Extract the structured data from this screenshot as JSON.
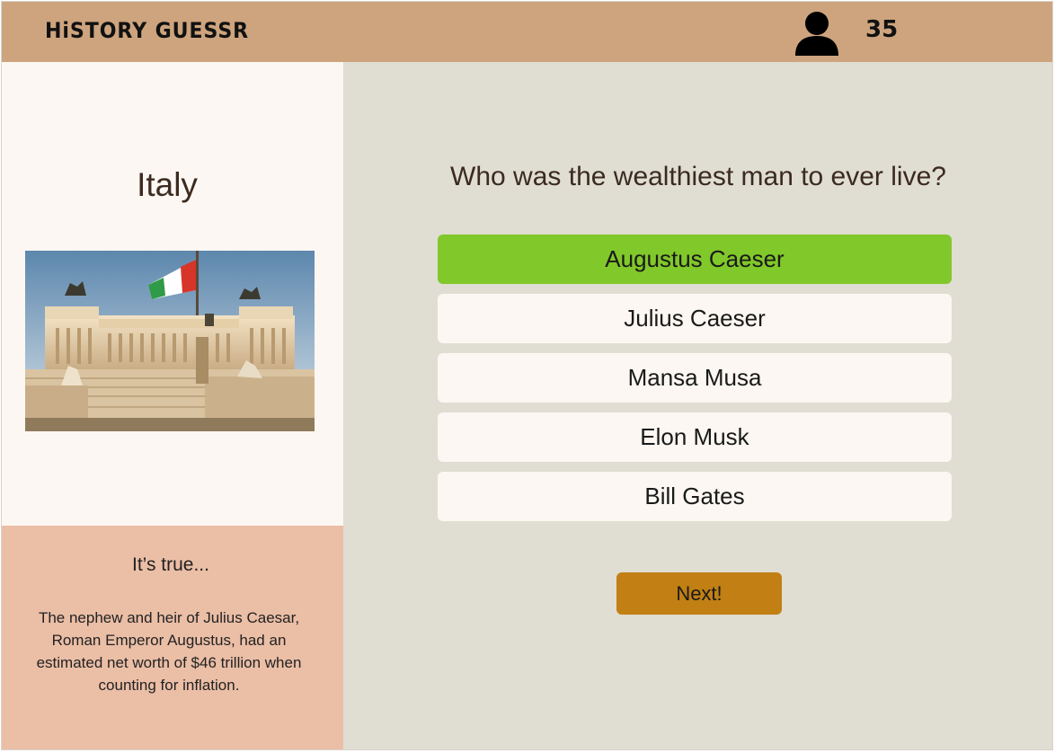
{
  "header": {
    "logo": "HiSTORY GUESSR",
    "score": "35",
    "user_icon": "user-icon"
  },
  "left_panel": {
    "country": "Italy",
    "image": "photo of the Altare della Patria monument in Rome with an Italian flag"
  },
  "fact": {
    "title": "It’s true...",
    "text": "The nephew and heir of Julius Caesar, Roman Emperor Augustus, had an estimated net worth of $46 trillion when counting for inflation."
  },
  "quiz": {
    "question": "Who was the wealthiest man to ever live?",
    "answers": [
      {
        "label": "Augustus Caeser",
        "selected": true
      },
      {
        "label": "Julius Caeser",
        "selected": false
      },
      {
        "label": "Mansa Musa",
        "selected": false
      },
      {
        "label": "Elon Musk",
        "selected": false
      },
      {
        "label": "Bill Gates",
        "selected": false
      }
    ],
    "next_label": "Next!"
  },
  "colors": {
    "header": "#cda47e",
    "main_bg": "#e0ddd2",
    "panel_bg": "#fcf7f2",
    "fact_bg": "#ebbea6",
    "selected_answer": "#81c82a",
    "next_button": "#c17f14",
    "text_dark": "#3b2a1f"
  }
}
